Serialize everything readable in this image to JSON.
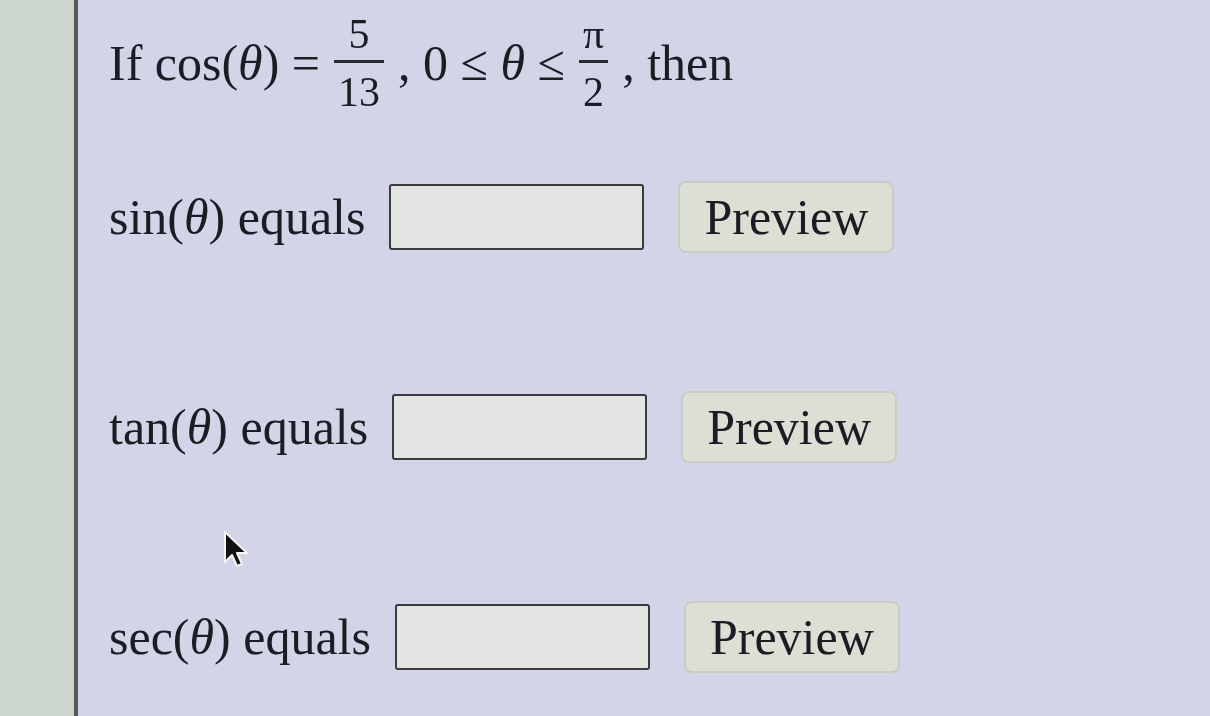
{
  "question": {
    "segments": [
      {
        "kind": "text",
        "text": "If cos(*θ*) ="
      },
      {
        "kind": "fraction",
        "numerator": "5",
        "denominator": "13"
      },
      {
        "kind": "text",
        "text": ", 0 ≤ *θ* ≤"
      },
      {
        "kind": "fraction",
        "numerator": "π",
        "denominator": "2"
      },
      {
        "kind": "text",
        "text": ", then"
      }
    ]
  },
  "answers": [
    {
      "label": "sin(*θ*) equals",
      "button": "Preview"
    },
    {
      "label": "tan(*θ*) equals",
      "button": "Preview"
    },
    {
      "label": "sec(*θ*) equals",
      "button": "Preview"
    }
  ]
}
